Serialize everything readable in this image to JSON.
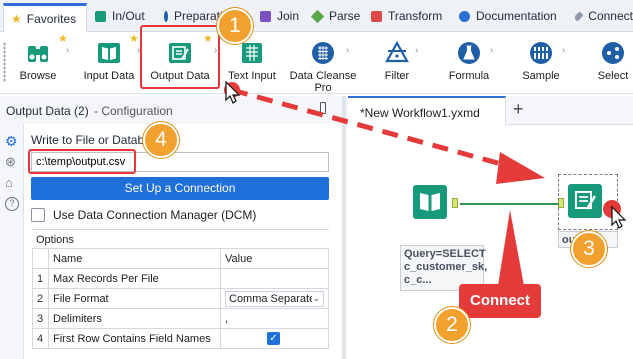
{
  "category_tabs": [
    {
      "label": "Favorites",
      "color": "#f2b824",
      "active": true
    },
    {
      "label": "In/Out",
      "color": "#17997b"
    },
    {
      "label": "Preparation",
      "color": "#1f5fa8"
    },
    {
      "label": "Join",
      "color": "#7a4fc2"
    },
    {
      "label": "Parse",
      "color": "#5aa845"
    },
    {
      "label": "Transform",
      "color": "#e04848"
    },
    {
      "label": "Documentation",
      "color": "#2a6fcf"
    },
    {
      "label": "Connect",
      "color": "#8f98a8"
    }
  ],
  "tools": [
    {
      "label": "Browse",
      "icon": "binoculars-icon"
    },
    {
      "label": "Input Data",
      "icon": "book-icon"
    },
    {
      "label": "Output Data",
      "icon": "output-data-icon"
    },
    {
      "label": "Text Input",
      "icon": "text-input-icon"
    },
    {
      "label": "Data Cleanse Pro",
      "icon": "data-cleanse-icon"
    },
    {
      "label": "Filter",
      "icon": "filter-icon"
    },
    {
      "label": "Formula",
      "icon": "formula-flask-icon"
    },
    {
      "label": "Sample",
      "icon": "sample-icon"
    },
    {
      "label": "Select",
      "icon": "select-icon"
    }
  ],
  "config_panel": {
    "title": "Output Data (2)",
    "subtitle": "- Configuration",
    "write_label": "Write to File or Datab",
    "path_value": "c:\\temp\\output.csv",
    "setup_button": "Set Up a Connection",
    "dcm_label": "Use Data Connection Manager (DCM)",
    "options_title": "Options",
    "table_headers": [
      "Name",
      "Value"
    ],
    "rows": [
      {
        "num": "1",
        "name": "Max Records Per File",
        "value": ""
      },
      {
        "num": "2",
        "name": "File Format",
        "value": "Comma Separate"
      },
      {
        "num": "3",
        "name": "Delimiters",
        "value": ","
      },
      {
        "num": "4",
        "name": "First Row Contains Field Names",
        "value": ""
      }
    ]
  },
  "workflow": {
    "tab_label": "*New Workflow1.yxmd",
    "add_tab": "+",
    "input_annotation": [
      "Query=SELECT",
      "c_customer_sk,",
      "c_c..."
    ],
    "output_annotation": "ou"
  },
  "overlays": {
    "step1": "1",
    "step2": "2",
    "step3": "3",
    "step4": "4",
    "connect_label": "Connect"
  },
  "colors": {
    "accent": "#1e6fd9",
    "callout_orange": "#f2a12e",
    "highlight_red": "#e8373a",
    "node_teal": "#17997b"
  }
}
